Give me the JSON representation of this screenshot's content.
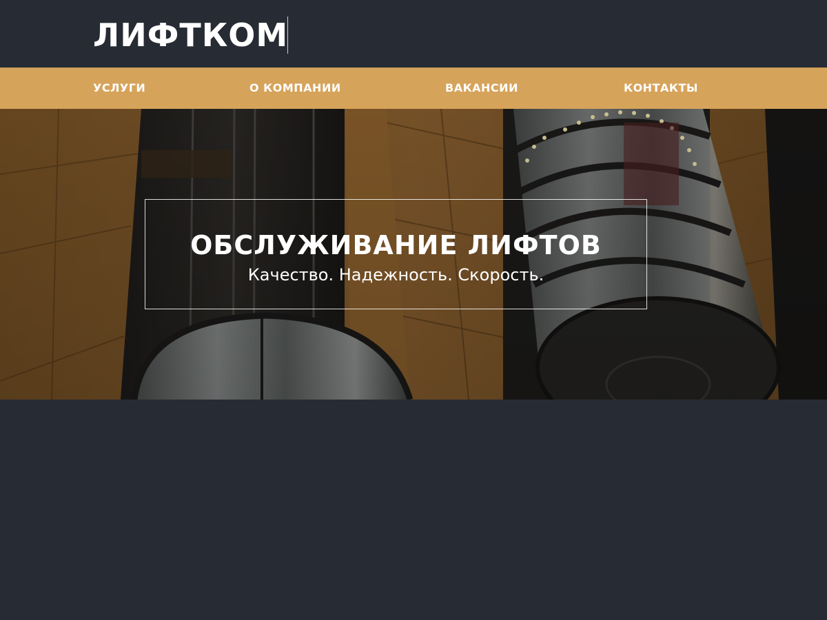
{
  "header": {
    "logo": "ЛИФТКОМ"
  },
  "nav": {
    "items": [
      {
        "label": "УСЛУГИ"
      },
      {
        "label": "О КОМПАНИИ"
      },
      {
        "label": "ВАКАНСИИ"
      },
      {
        "label": "КОНТАКТЫ"
      }
    ]
  },
  "hero": {
    "title": "ОБСЛУЖИВАНИЕ ЛИФТОВ",
    "subtitle": "Качество. Надежность. Скорость."
  },
  "colors": {
    "background": "#272c34",
    "nav_accent": "#d6a35a",
    "text": "#ffffff"
  }
}
